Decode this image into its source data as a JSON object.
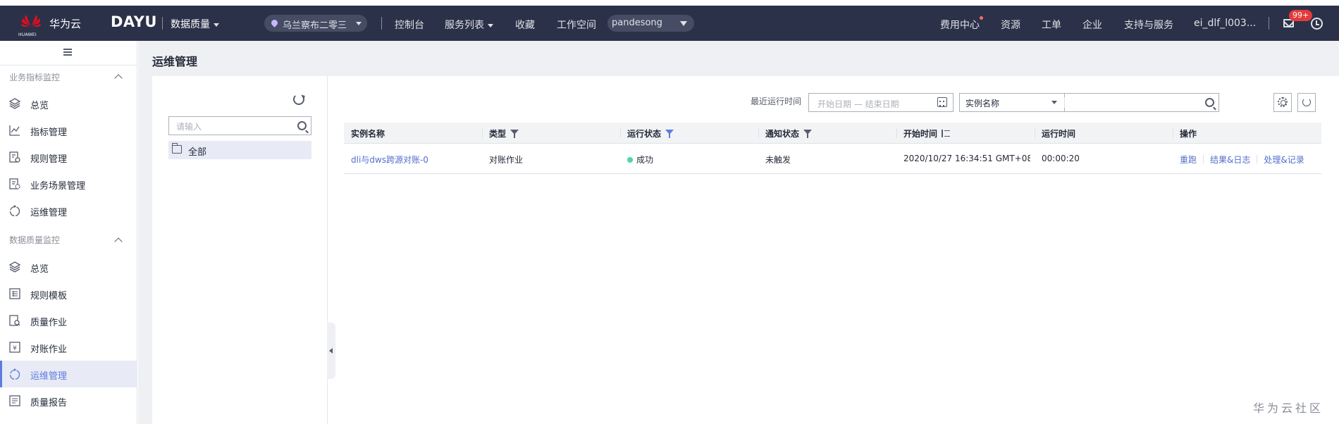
{
  "topbar": {
    "brand": "华为云",
    "logo_text": "HUAWEI",
    "product": "DAYU",
    "module": "数据质量",
    "region": "乌兰察布二零三",
    "nav": [
      "控制台",
      "服务列表",
      "收藏",
      "工作空间"
    ],
    "workspace": "pandesong",
    "right_nav": [
      "费用中心",
      "资源",
      "工单",
      "企业",
      "支持与服务"
    ],
    "user": "ei_dlf_l003...",
    "badge": "99+"
  },
  "sidebar": {
    "groups": [
      {
        "title": "业务指标监控",
        "items": [
          {
            "label": "总览",
            "icon": "layers-icon"
          },
          {
            "label": "指标管理",
            "icon": "chart-icon"
          },
          {
            "label": "规则管理",
            "icon": "rule-doc-icon"
          },
          {
            "label": "业务场景管理",
            "icon": "scene-icon"
          },
          {
            "label": "运维管理",
            "icon": "cycle-icon"
          }
        ]
      },
      {
        "title": "数据质量监控",
        "items": [
          {
            "label": "总览",
            "icon": "layers-icon"
          },
          {
            "label": "规则模板",
            "icon": "template-icon"
          },
          {
            "label": "质量作业",
            "icon": "quality-job-icon"
          },
          {
            "label": "对账作业",
            "icon": "reconcile-icon"
          },
          {
            "label": "运维管理",
            "icon": "cycle-icon",
            "active": true
          },
          {
            "label": "质量报告",
            "icon": "report-icon"
          }
        ]
      }
    ]
  },
  "page": {
    "title": "运维管理",
    "tree_search_placeholder": "请输入",
    "tree_root": "全部",
    "filter_label": "最近运行时间",
    "date_placeholder": "开始日期 — 结束日期",
    "attr_select": "实例名称"
  },
  "table": {
    "headers": [
      "实例名称",
      "类型",
      "运行状态",
      "通知状态",
      "开始时间",
      "运行时间",
      "操作"
    ],
    "rows": [
      {
        "name": "dli与dws跨源对账-0",
        "type": "对账作业",
        "status": "成功",
        "notify": "未触发",
        "start": "2020/10/27 16:34:51 GMT+08:...",
        "duration": "00:00:20",
        "actions": [
          "重跑",
          "结果&日志",
          "处理&记录"
        ]
      }
    ]
  },
  "watermark": "华为云社区",
  "colors": {
    "topbar": "#2b3148",
    "accent": "#5e7ce0",
    "link": "#526ecc",
    "success": "#50d4ab"
  }
}
